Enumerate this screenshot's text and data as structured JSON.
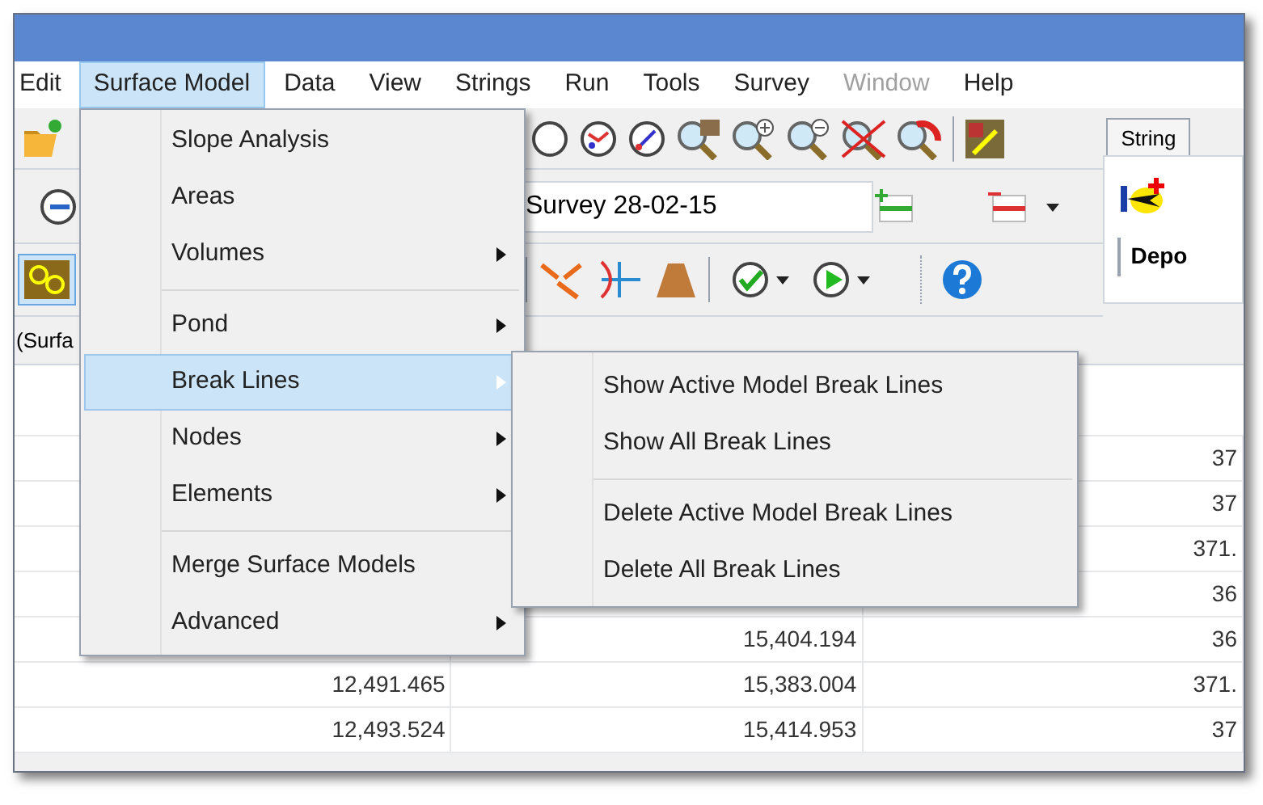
{
  "menubar": [
    {
      "label": "Edit",
      "selected": false,
      "disabled": false
    },
    {
      "label": "Surface Model",
      "selected": true,
      "disabled": false
    },
    {
      "label": "Data",
      "selected": false,
      "disabled": false
    },
    {
      "label": "View",
      "selected": false,
      "disabled": false
    },
    {
      "label": "Strings",
      "selected": false,
      "disabled": false
    },
    {
      "label": "Run",
      "selected": false,
      "disabled": false
    },
    {
      "label": "Tools",
      "selected": false,
      "disabled": false
    },
    {
      "label": "Survey",
      "selected": false,
      "disabled": false
    },
    {
      "label": "Window",
      "selected": false,
      "disabled": true
    },
    {
      "label": "Help",
      "selected": false,
      "disabled": false
    }
  ],
  "survey_combo": {
    "value": "Survey 28-02-15"
  },
  "side_panel": {
    "tab": "String",
    "label": "Depo"
  },
  "model_label": "(Surfa",
  "table": {
    "rows": [
      [
        "",
        "",
        "37"
      ],
      [
        "",
        "",
        "37"
      ],
      [
        "",
        "",
        "371."
      ],
      [
        "",
        "",
        "36"
      ],
      [
        "",
        "15,404.194",
        "36"
      ],
      [
        "12,491.465",
        "15,383.004",
        "371."
      ],
      [
        "12,493.524",
        "15,414.953",
        "37"
      ]
    ]
  },
  "menu": {
    "items": [
      {
        "kind": "item",
        "label": "Slope Analysis",
        "has_submenu": false,
        "selected": false
      },
      {
        "kind": "item",
        "label": "Areas",
        "has_submenu": false,
        "selected": false
      },
      {
        "kind": "item",
        "label": "Volumes",
        "has_submenu": true,
        "selected": false
      },
      {
        "kind": "separator"
      },
      {
        "kind": "item",
        "label": "Pond",
        "has_submenu": true,
        "selected": false
      },
      {
        "kind": "item",
        "label": "Break Lines",
        "has_submenu": true,
        "selected": true
      },
      {
        "kind": "item",
        "label": "Nodes",
        "has_submenu": true,
        "selected": false
      },
      {
        "kind": "item",
        "label": "Elements",
        "has_submenu": true,
        "selected": false
      },
      {
        "kind": "separator"
      },
      {
        "kind": "item",
        "label": "Merge Surface Models",
        "has_submenu": false,
        "selected": false
      },
      {
        "kind": "item",
        "label": "Advanced",
        "has_submenu": true,
        "selected": false
      }
    ]
  },
  "submenu": {
    "items": [
      {
        "kind": "item",
        "label": "Show Active Model Break Lines",
        "selected": false
      },
      {
        "kind": "item",
        "label": "Show All Break Lines",
        "selected": false
      },
      {
        "kind": "separator"
      },
      {
        "kind": "item",
        "label": "Delete Active Model Break Lines",
        "selected": false
      },
      {
        "kind": "item",
        "label": "Delete All Break Lines",
        "selected": false
      }
    ]
  }
}
